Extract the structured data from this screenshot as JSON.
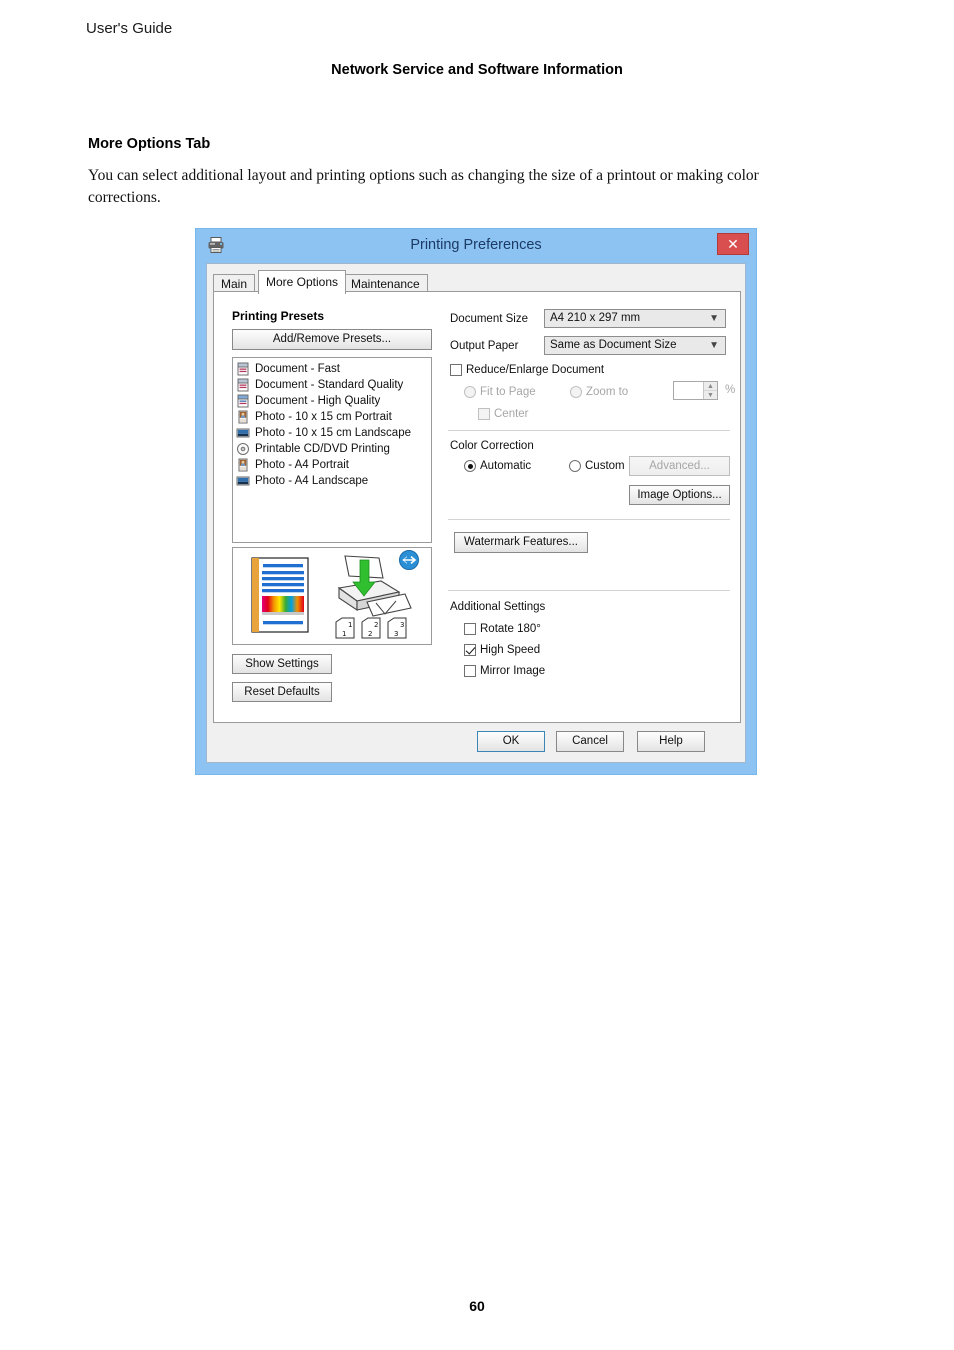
{
  "page": {
    "header": "User's Guide",
    "section_title": "Network Service and Software Information",
    "heading": "More Options Tab",
    "body": "You can select additional layout and printing options such as changing the size of a printout or making color corrections.",
    "page_number": "60"
  },
  "dialog": {
    "title": "Printing Preferences",
    "title_icon": "printer-icon",
    "close_label": "✕",
    "titlebar_color": "#8cc3f2",
    "close_color": "#d94f4f",
    "tabs": [
      {
        "label": "Main",
        "active": false
      },
      {
        "label": "More Options",
        "active": true
      },
      {
        "label": "Maintenance",
        "active": false
      }
    ],
    "left": {
      "presets_title": "Printing Presets",
      "add_remove_label": "Add/Remove Presets...",
      "presets": [
        {
          "label": "Document - Fast",
          "icon": "document-preset-icon"
        },
        {
          "label": "Document - Standard Quality",
          "icon": "document-preset-icon"
        },
        {
          "label": "Document - High Quality",
          "icon": "document-hq-preset-icon"
        },
        {
          "label": "Photo - 10 x 15 cm Portrait",
          "icon": "photo-portrait-icon"
        },
        {
          "label": "Photo - 10 x 15 cm Landscape",
          "icon": "photo-landscape-icon"
        },
        {
          "label": "Printable CD/DVD Printing",
          "icon": "cd-disc-icon"
        },
        {
          "label": "Photo - A4 Portrait",
          "icon": "photo-portrait-icon"
        },
        {
          "label": "Photo - A4 Landscape",
          "icon": "photo-landscape-icon"
        }
      ],
      "preview": {
        "page_numbers": [
          "1",
          "2",
          "3"
        ],
        "page_number_badges": [
          "1",
          "2",
          "3"
        ]
      },
      "show_settings_label": "Show Settings",
      "reset_defaults_label": "Reset Defaults"
    },
    "right": {
      "document_size_label": "Document Size",
      "document_size_value": "A4 210 x 297 mm",
      "output_paper_label": "Output Paper",
      "output_paper_value": "Same as Document Size",
      "reduce_enlarge_label": "Reduce/Enlarge Document",
      "reduce_enlarge_checked": false,
      "fit_to_page_label": "Fit to Page",
      "zoom_to_label": "Zoom to",
      "zoom_value": "",
      "percent_label": "%",
      "center_label": "Center",
      "color_correction_label": "Color Correction",
      "automatic_label": "Automatic",
      "automatic_selected": true,
      "custom_label": "Custom",
      "custom_selected": false,
      "advanced_label": "Advanced...",
      "advanced_enabled": false,
      "image_options_label": "Image Options...",
      "watermark_label": "Watermark Features...",
      "additional_settings_label": "Additional Settings",
      "rotate_label": "Rotate 180°",
      "rotate_checked": false,
      "high_speed_label": "High Speed",
      "high_speed_checked": true,
      "mirror_label": "Mirror Image",
      "mirror_checked": false
    },
    "footer": {
      "ok_label": "OK",
      "cancel_label": "Cancel",
      "help_label": "Help"
    }
  }
}
